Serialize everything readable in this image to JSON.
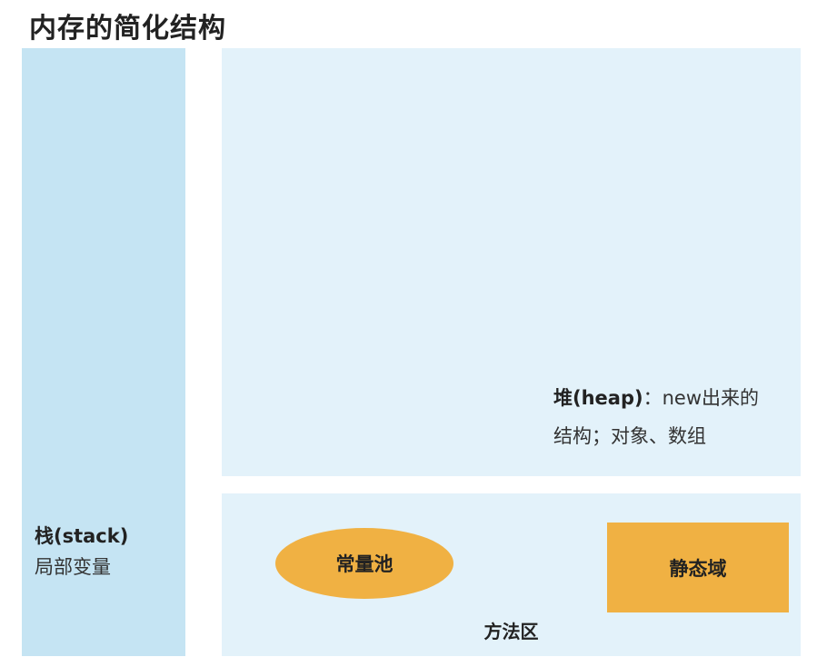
{
  "title": "内存的简化结构",
  "stack": {
    "label": "栈(stack)",
    "description": "局部变量"
  },
  "heap": {
    "label": "堆(heap)",
    "separator": "：",
    "description_line1": "new出来的",
    "description_line2": "结构；对象、数组"
  },
  "method_area": {
    "label": "方法区",
    "constant_pool": "常量池",
    "static_field": "静态域"
  },
  "colors": {
    "stack_fill": "#c5e4f3",
    "region_fill": "#e3f2fa",
    "accent_fill": "#f0b143"
  }
}
